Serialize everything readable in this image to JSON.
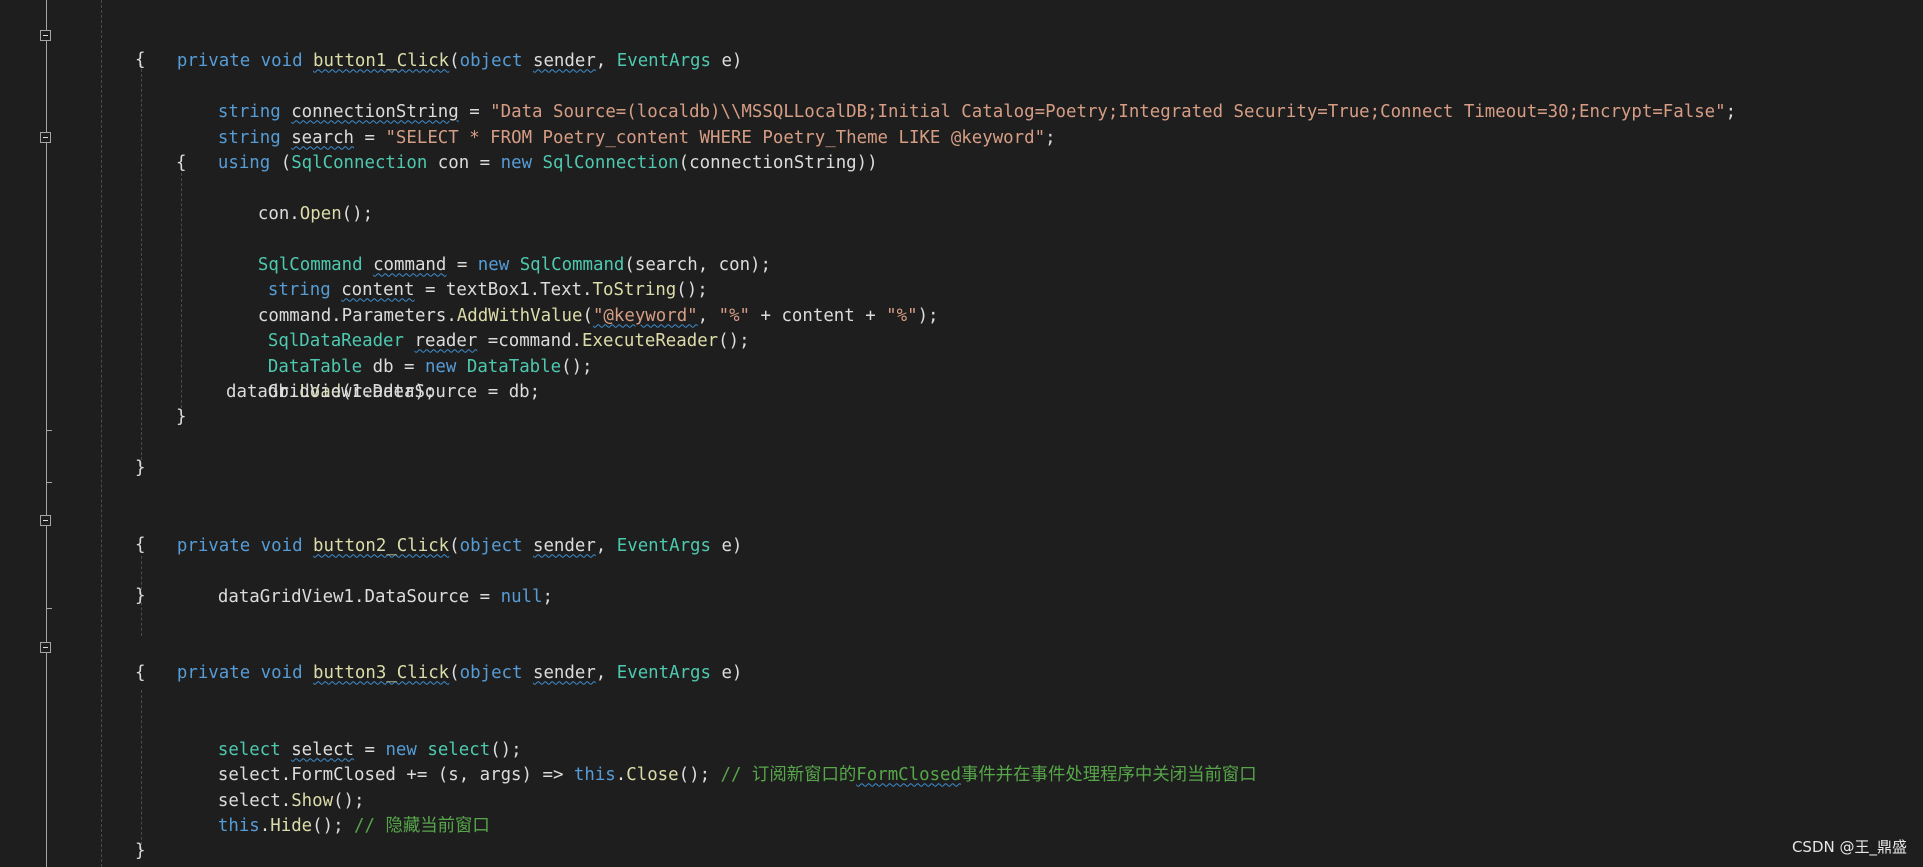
{
  "code": {
    "l01": {
      "kw1": "private",
      "kw2": "void",
      "fn": "button1_Click",
      "p1": "(",
      "kw3": "object",
      "v1": "sender",
      "p2": ", ",
      "ty": "EventArgs",
      "p3": " e)"
    },
    "l02": {
      "t": "{"
    },
    "l03": {
      "kw": "string",
      "v": "connectionString",
      "op": " = ",
      "str": "\"Data Source=(localdb)\\\\MSSQLLocalDB;Initial Catalog=Poetry;Integrated Security=True;Connect Timeout=30;Encrypt=False\"",
      "end": ";"
    },
    "l04": {
      "kw": "string",
      "v": "search",
      "op": " = ",
      "str": "\"SELECT * FROM Poetry_content WHERE Poetry_Theme LIKE @keyword\"",
      "end": ";"
    },
    "l05": {
      "kw1": "using",
      "p1": " (",
      "ty1": "SqlConnection",
      "p2": " con = ",
      "kw2": "new",
      "sp": " ",
      "ty2": "SqlConnection",
      "p3": "(connectionString))"
    },
    "l06": {
      "t": "{"
    },
    "l07": {
      "a": "con.",
      "fn": "Open",
      "b": "();"
    },
    "l09": {
      "ty1": "SqlCommand",
      "v": "command",
      "op": " = ",
      "kw": "new",
      "ty2": "SqlCommand",
      "b": "(search, con);"
    },
    "l10": {
      "kw": "string",
      "v": "content",
      "op": " = textBox1.Text.",
      "fn": "ToString",
      "b": "();"
    },
    "l11": {
      "a": "command.Parameters.",
      "fn": "AddWithValue",
      "p1": "(",
      "s1": "\"@keyword\"",
      "p2": ", ",
      "s2": "\"%\"",
      "p3": " + content + ",
      "s3": "\"%\"",
      "p4": ");"
    },
    "l12": {
      "ty": "SqlDataReader",
      "v": "reader",
      "op": " =command.",
      "fn": "ExecuteReader",
      "b": "();"
    },
    "l13": {
      "ty1": "DataTable",
      "a": " db = ",
      "kw": "new",
      "ty2": "DataTable",
      "b": "();"
    },
    "l14": {
      "a": "db.",
      "fn": "Load",
      "b": "(reader);"
    },
    "l15": {
      "t": "dataGridView1.DataSource = db;"
    },
    "l16": {
      "t": "}"
    },
    "l18": {
      "t": "}"
    },
    "l20": {
      "kw1": "private",
      "kw2": "void",
      "fn": "button2_Click",
      "p1": "(",
      "kw3": "object",
      "v1": "sender",
      "p2": ", ",
      "ty": "EventArgs",
      "p3": " e)"
    },
    "l21": {
      "t": "{"
    },
    "l22": {
      "a": "dataGridView1.DataSource = ",
      "kw": "null",
      "b": ";"
    },
    "l23": {
      "t": "}"
    },
    "l25": {
      "kw1": "private",
      "kw2": "void",
      "fn": "button3_Click",
      "p1": "(",
      "kw3": "object",
      "v1": "sender",
      "p2": ", ",
      "ty": "EventArgs",
      "p3": " e)"
    },
    "l26": {
      "t": "{"
    },
    "l28": {
      "ty1": "select",
      "v": "select",
      "op": " = ",
      "kw": "new",
      "ty2": "select",
      "b": "();"
    },
    "l29": {
      "a": "select.",
      "ev": "FormClosed",
      "b": " += (s, args) => ",
      "kw": "this",
      "c": ".",
      "fn": "Close",
      "d": "(); ",
      "cmt1": "// 订阅新窗口的",
      "cmtu": "FormClosed",
      "cmt2": "事件并在事件处理程序中关闭当前窗口"
    },
    "l30": {
      "a": "select.",
      "fn": "Show",
      "b": "();"
    },
    "l31": {
      "kw": "this",
      "c": ".",
      "fn": "Hide",
      "d": "(); ",
      "cmt": "// 隐藏当前窗口"
    },
    "l33": {
      "t": "}"
    }
  },
  "watermark": "CSDN @王_鼎盛",
  "colors": {
    "background": "#1e1e1e",
    "keyword": "#569cd6",
    "type": "#4ec9b0",
    "method": "#dcdcaa",
    "string": "#d69d85",
    "comment": "#57a64a",
    "plain": "#dcdcdc"
  }
}
